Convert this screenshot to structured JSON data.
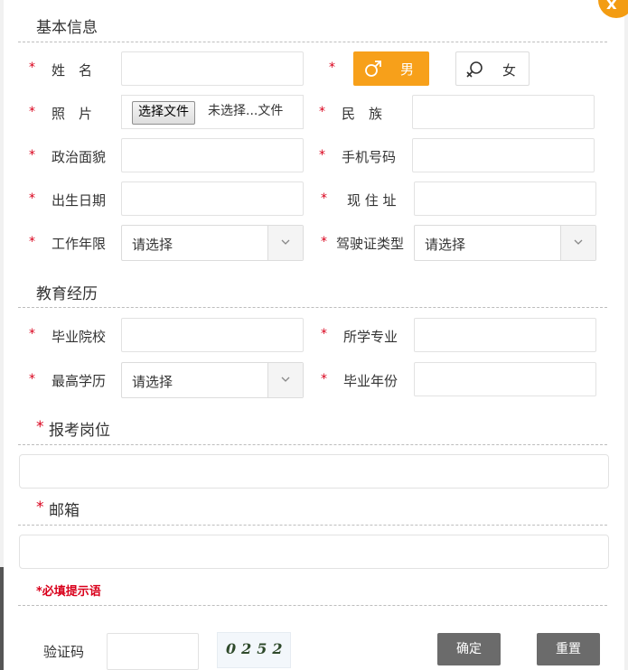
{
  "close_label": "x",
  "basic": {
    "title": "基本信息",
    "name_label": "姓　名",
    "gender_star": "*",
    "male_label": "男",
    "female_label": "女",
    "photo_label": "照　片",
    "file_button": "选择文件",
    "file_status": "未选择...文件",
    "ethnicity_label": "民　族",
    "political_label": "政治面貌",
    "phone_label": "手机号码",
    "birth_label": "出生日期",
    "address_label": "现 住 址",
    "work_years_label": "工作年限",
    "work_years_placeholder": "请选择",
    "license_label": "驾驶证类型",
    "license_placeholder": "请选择"
  },
  "education": {
    "title": "教育经历",
    "school_label": "毕业院校",
    "major_label": "所学专业",
    "degree_label": "最高学历",
    "degree_placeholder": "请选择",
    "grad_year_label": "毕业年份"
  },
  "position": {
    "title": "报考岗位"
  },
  "email": {
    "title": "邮箱"
  },
  "required_mark": "*",
  "hint": "*必填提示语",
  "captcha": {
    "label": "验证码",
    "code": "0252"
  },
  "actions": {
    "confirm": "确定",
    "reset": "重置"
  },
  "colors": {
    "accent": "#f7a01a",
    "required": "#d9001b",
    "button_dark": "#6b6b6b"
  }
}
